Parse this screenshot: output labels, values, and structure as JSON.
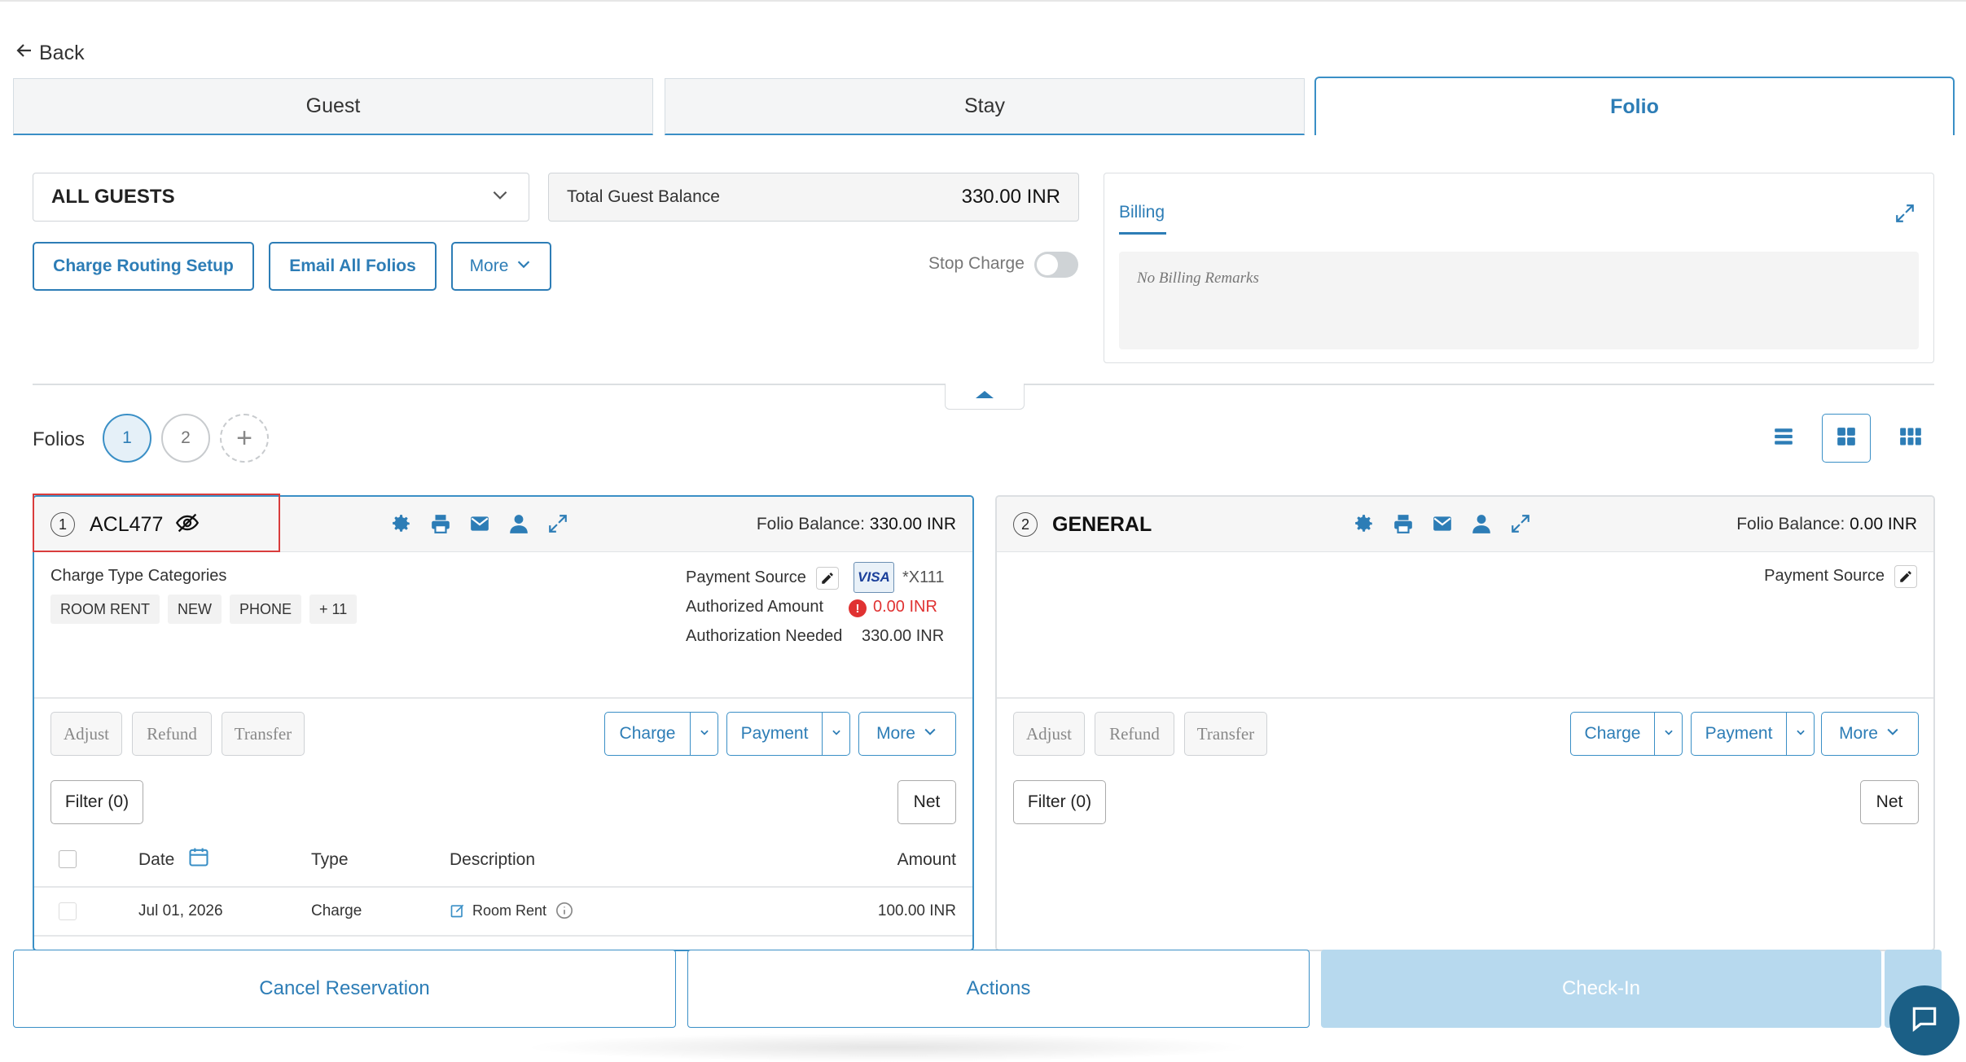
{
  "nav": {
    "back": "Back"
  },
  "tabs": [
    "Guest",
    "Stay",
    "Folio"
  ],
  "guest_select": {
    "value": "ALL GUESTS"
  },
  "total_balance": {
    "label": "Total Guest Balance",
    "value": "330.00 INR"
  },
  "buttons": {
    "charge_routing": "Charge Routing Setup",
    "email_all": "Email All Folios",
    "more": "More"
  },
  "stop_charge": {
    "label": "Stop Charge",
    "on": false
  },
  "billing": {
    "tab": "Billing",
    "remarks": "No Billing Remarks"
  },
  "folios": {
    "label": "Folios",
    "items": [
      "1",
      "2"
    ],
    "active": "1"
  },
  "folio1": {
    "num": "1",
    "name": "ACL477",
    "balance_label": "Folio Balance:",
    "balance": "330.00 INR",
    "categories_label": "Charge Type Categories",
    "chips": [
      "ROOM RENT",
      "NEW",
      "PHONE",
      "+ 11"
    ],
    "payment_source_label": "Payment Source",
    "card_mask": "*X111",
    "card_brand": "VISA",
    "authorized_label": "Authorized Amount",
    "authorized_value": "0.00 INR",
    "auth_needed_label": "Authorization Needed",
    "auth_needed_value": "330.00 INR",
    "actions": {
      "adjust": "Adjust",
      "refund": "Refund",
      "transfer": "Transfer",
      "charge": "Charge",
      "payment": "Payment",
      "more": "More"
    },
    "filter": "Filter (0)",
    "net": "Net",
    "columns": {
      "date": "Date",
      "type": "Type",
      "description": "Description",
      "amount": "Amount"
    },
    "rows": [
      {
        "date": "Jul 01, 2026",
        "type": "Charge",
        "description": "Room Rent",
        "amount": "100.00 INR"
      }
    ]
  },
  "folio2": {
    "num": "2",
    "name": "GENERAL",
    "balance_label": "Folio Balance:",
    "balance": "0.00 INR",
    "payment_source_label": "Payment Source",
    "actions": {
      "adjust": "Adjust",
      "refund": "Refund",
      "transfer": "Transfer",
      "charge": "Charge",
      "payment": "Payment",
      "more": "More"
    },
    "filter": "Filter (0)",
    "net": "Net"
  },
  "footer": {
    "cancel": "Cancel Reservation",
    "actions": "Actions",
    "checkin": "Check-In"
  },
  "colors": {
    "accent": "#2d7db6",
    "highlight": "#d93c3c",
    "alert": "#e03232",
    "disabled": "#b7d9ee"
  }
}
